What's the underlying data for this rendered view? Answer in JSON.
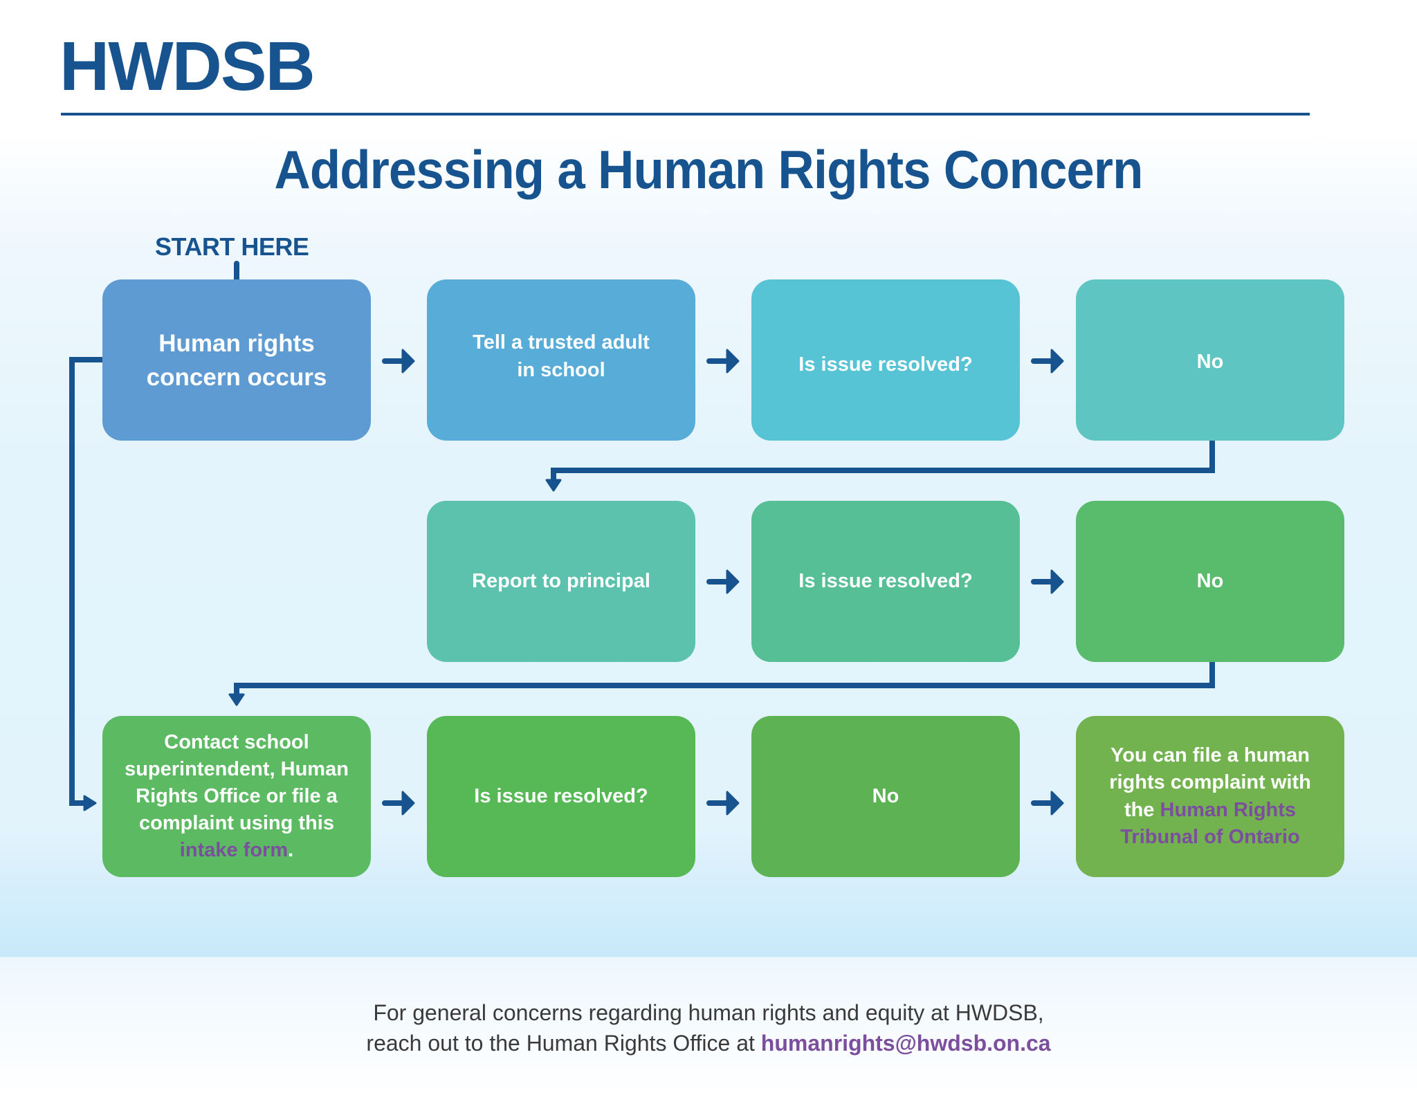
{
  "header": {
    "logo": "HWDSB",
    "title": "Addressing a Human Rights Concern"
  },
  "start_label": "START HERE",
  "colors": {
    "brand_blue": "#17548f",
    "link_purple": "#7b4f9e",
    "box_human_rights": "#5e9bd3",
    "box_trusted_adult": "#58acd8",
    "box_resolved_1": "#57c4d5",
    "box_no_1": "#5ec5c3",
    "box_report_principal": "#5cc2ad",
    "box_resolved_2": "#56bf95",
    "box_no_2": "#59bb6c",
    "box_contact": "#5cbb62",
    "box_resolved_3": "#56b955",
    "box_no_3": "#5db354",
    "box_tribunal": "#72b24f"
  },
  "steps": {
    "human_rights": {
      "line1": "Human rights",
      "line2": "concern occurs"
    },
    "trusted_adult": {
      "line1": "Tell a trusted adult",
      "line2": "in school"
    },
    "resolved_1": "Is issue resolved?",
    "no_1": "No",
    "report_principal": "Report to principal",
    "resolved_2": "Is issue resolved?",
    "no_2": "No",
    "contact": {
      "line1": "Contact school",
      "line2": "superintendent, Human",
      "line3": "Rights Office or file a",
      "line4": "complaint using this",
      "link": "intake form",
      "suffix": "."
    },
    "resolved_3": "Is issue resolved?",
    "no_3": "No",
    "tribunal": {
      "line1": "You can file a human",
      "line2": "rights complaint with",
      "prefix": "the ",
      "link_line1": "Human Rights",
      "link_line2": "Tribunal of Ontario"
    }
  },
  "footer": {
    "line1": "For general concerns regarding human rights and equity at HWDSB,",
    "line2": "reach out to the Human Rights Office at ",
    "email": "humanrights@hwdsb.on.ca"
  }
}
